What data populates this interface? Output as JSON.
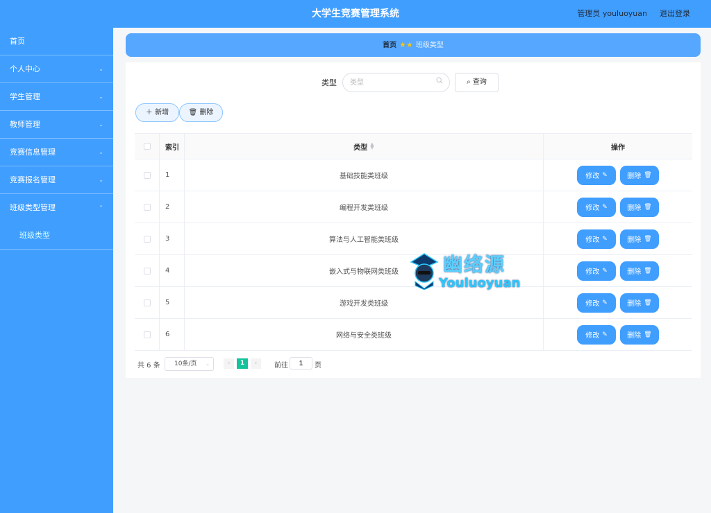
{
  "header": {
    "title": "大学生竞赛管理系统",
    "user": "管理员 youluoyuan",
    "logout": "退出登录"
  },
  "sidebar": {
    "items": [
      {
        "label": "首页",
        "has_arrow": false
      },
      {
        "label": "个人中心",
        "has_arrow": true
      },
      {
        "label": "学生管理",
        "has_arrow": true
      },
      {
        "label": "教师管理",
        "has_arrow": true
      },
      {
        "label": "竞赛信息管理",
        "has_arrow": true
      },
      {
        "label": "竞赛报名管理",
        "has_arrow": true
      },
      {
        "label": "班级类型管理",
        "has_arrow": true
      }
    ],
    "sub_item": "班级类型"
  },
  "breadcrumb": {
    "home": "首页",
    "stars": "★★",
    "current": "班级类型"
  },
  "search": {
    "label": "类型",
    "placeholder": "类型",
    "query_button": "查询",
    "query_icon": "search-icon"
  },
  "toolbar": {
    "add_button": "新增",
    "add_icon": "plus-icon",
    "delete_button": "删除",
    "delete_icon": "trash-icon"
  },
  "table": {
    "columns": [
      "索引",
      "类型",
      "操作"
    ],
    "rows": [
      {
        "index": "1",
        "type": "基础技能类班级"
      },
      {
        "index": "2",
        "type": "编程开发类班级"
      },
      {
        "index": "3",
        "type": "算法与人工智能类班级"
      },
      {
        "index": "4",
        "type": "嵌入式与物联网类班级"
      },
      {
        "index": "5",
        "type": "游戏开发类班级"
      },
      {
        "index": "6",
        "type": "网络与安全类班级"
      }
    ],
    "edit_label": "修改",
    "edit_icon": "edit-icon",
    "delete_label": "删除",
    "delete_icon": "trash-icon"
  },
  "pagination": {
    "total": "共 6 条",
    "page_size": "10条/页",
    "current_page": "1",
    "goto_label": "前往",
    "goto_value": "1",
    "goto_unit": "页"
  },
  "watermark": {
    "cn": "幽络源",
    "en": "Youluoyuan"
  },
  "colors": {
    "primary": "#409eff",
    "breadcrumb_bg": "#55a7ff",
    "page_active": "#13c39c",
    "background": "#f5f6f8"
  }
}
